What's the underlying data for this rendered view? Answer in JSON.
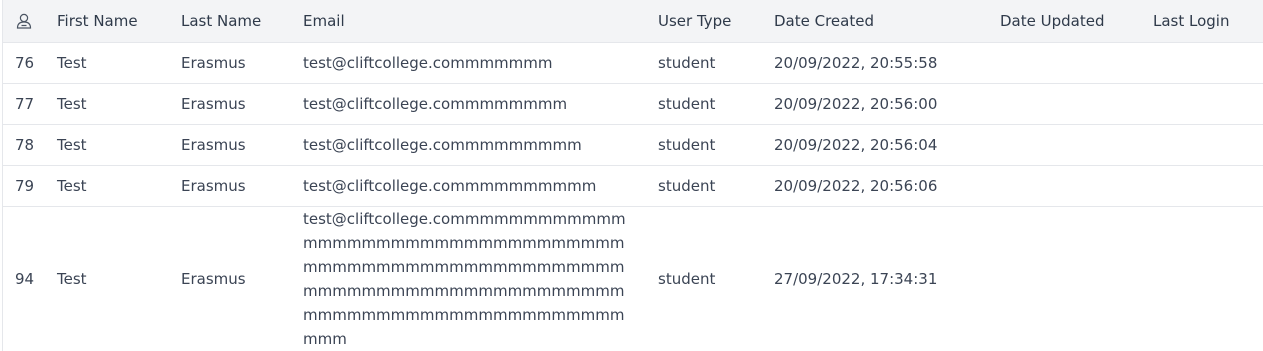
{
  "columns": {
    "id_icon": "user-icon",
    "first_name": "First Name",
    "last_name": "Last Name",
    "email": "Email",
    "user_type": "User Type",
    "date_created": "Date Created",
    "date_updated": "Date Updated",
    "last_login": "Last Login"
  },
  "rows": [
    {
      "id": "76",
      "first_name": "Test",
      "last_name": "Erasmus",
      "email": "test@cliftcollege.commmmmmm",
      "user_type": "student",
      "date_created": "20/09/2022, 20:55:58",
      "date_updated": "",
      "last_login": ""
    },
    {
      "id": "77",
      "first_name": "Test",
      "last_name": "Erasmus",
      "email": "test@cliftcollege.commmmmmmm",
      "user_type": "student",
      "date_created": "20/09/2022, 20:56:00",
      "date_updated": "",
      "last_login": ""
    },
    {
      "id": "78",
      "first_name": "Test",
      "last_name": "Erasmus",
      "email": "test@cliftcollege.commmmmmmmm",
      "user_type": "student",
      "date_created": "20/09/2022, 20:56:04",
      "date_updated": "",
      "last_login": ""
    },
    {
      "id": "79",
      "first_name": "Test",
      "last_name": "Erasmus",
      "email": "test@cliftcollege.commmmmmmmmm",
      "user_type": "student",
      "date_created": "20/09/2022, 20:56:06",
      "date_updated": "",
      "last_login": ""
    },
    {
      "id": "94",
      "first_name": "Test",
      "last_name": "Erasmus",
      "email": "test@cliftcollege.commmmmmmmmmmmmmmmmmmmmmmmmmmmmmmmmmmmmmmmmmmmmmmmmmmmmmmmmmmmmmmmmmmmmmmmmmmmmmmmmmmmmmmmmmmmmmmmmmmmmmm",
      "user_type": "student",
      "date_created": "27/09/2022, 17:34:31",
      "date_updated": "",
      "last_login": ""
    }
  ]
}
